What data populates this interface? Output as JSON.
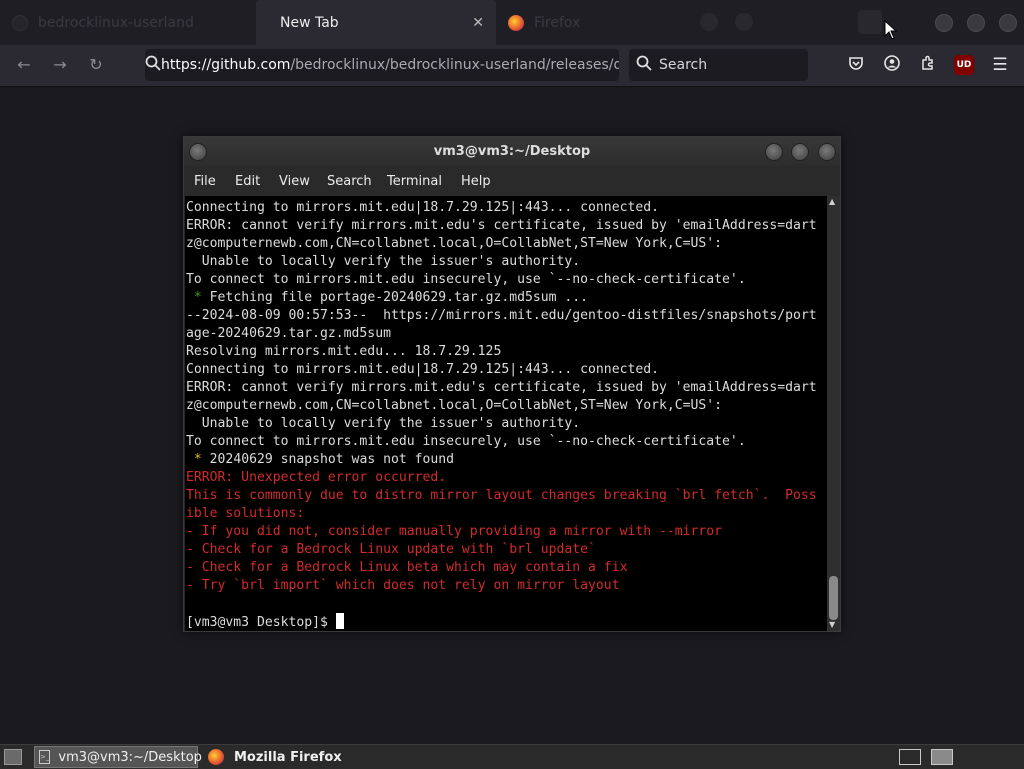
{
  "browser": {
    "tabs": [
      {
        "label": "bedrocklinux-userland",
        "state": "inactive"
      },
      {
        "label": "New Tab",
        "state": "active"
      },
      {
        "label": "Firefox",
        "state": "inactive"
      }
    ],
    "url_host": "https://github.com",
    "url_path": "/bedrocklinux/bedrocklinux-userland/releases/do",
    "search_placeholder": "Search",
    "ublock_badge": "UD"
  },
  "terminal": {
    "title": "vm3@vm3:~/Desktop",
    "menu": [
      "File",
      "Edit",
      "View",
      "Search",
      "Terminal",
      "Help"
    ],
    "lines": [
      {
        "text": "Connecting to mirrors.mit.edu|18.7.29.125|:443... connected.",
        "style": "normal"
      },
      {
        "text": "ERROR: cannot verify mirrors.mit.edu's certificate, issued by 'emailAddress=dart",
        "style": "normal"
      },
      {
        "text": "z@computernewb.com,CN=collabnet.local,O=CollabNet,ST=New York,C=US':",
        "style": "normal"
      },
      {
        "text": "  Unable to locally verify the issuer's authority.",
        "style": "normal"
      },
      {
        "text": "To connect to mirrors.mit.edu insecurely, use `--no-check-certificate'.",
        "style": "normal"
      },
      {
        "text": " * Fetching file portage-20240629.tar.gz.md5sum ...",
        "style": "star-green"
      },
      {
        "text": "--2024-08-09 00:57:53--  https://mirrors.mit.edu/gentoo-distfiles/snapshots/port",
        "style": "normal"
      },
      {
        "text": "age-20240629.tar.gz.md5sum",
        "style": "normal"
      },
      {
        "text": "Resolving mirrors.mit.edu... 18.7.29.125",
        "style": "normal"
      },
      {
        "text": "Connecting to mirrors.mit.edu|18.7.29.125|:443... connected.",
        "style": "normal"
      },
      {
        "text": "ERROR: cannot verify mirrors.mit.edu's certificate, issued by 'emailAddress=dart",
        "style": "normal"
      },
      {
        "text": "z@computernewb.com,CN=collabnet.local,O=CollabNet,ST=New York,C=US':",
        "style": "normal"
      },
      {
        "text": "  Unable to locally verify the issuer's authority.",
        "style": "normal"
      },
      {
        "text": "To connect to mirrors.mit.edu insecurely, use `--no-check-certificate'.",
        "style": "normal"
      },
      {
        "text": " * 20240629 snapshot was not found",
        "style": "star-yellow"
      },
      {
        "text": "ERROR: Unexpected error occurred.",
        "style": "error"
      },
      {
        "text": "This is commonly due to distro mirror layout changes breaking `brl fetch`.  Poss",
        "style": "error"
      },
      {
        "text": "ible solutions:",
        "style": "error"
      },
      {
        "text": "- If you did not, consider manually providing a mirror with --mirror",
        "style": "error"
      },
      {
        "text": "- Check for a Bedrock Linux update with `brl update`",
        "style": "error"
      },
      {
        "text": "- Check for a Bedrock Linux beta which may contain a fix",
        "style": "error"
      },
      {
        "text": "- Try `brl import` which does not rely on mirror layout",
        "style": "error"
      },
      {
        "text": "",
        "style": "normal"
      }
    ],
    "prompt": "[vm3@vm3 Desktop]$ "
  },
  "taskbar": {
    "items": [
      "vm3@vm3:~/Desktop",
      "Mozilla Firefox"
    ]
  }
}
